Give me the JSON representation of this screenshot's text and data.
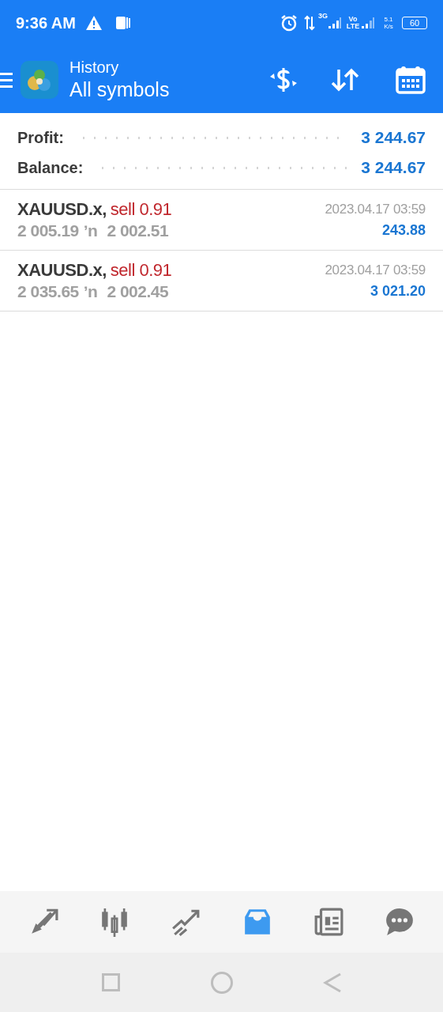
{
  "status_bar": {
    "time": "9:36 AM",
    "network_1": "3G",
    "network_2": "Vo LTE",
    "speed": "5.1 K/s",
    "battery": "60"
  },
  "header": {
    "title": "History",
    "subtitle": "All symbols"
  },
  "summary": [
    {
      "label": "Profit:",
      "value": "3 244.67"
    },
    {
      "label": "Balance:",
      "value": "3 244.67"
    }
  ],
  "deals": [
    {
      "symbol": "XAUUSD.x,",
      "action": "sell 0.91",
      "open_price": "2 005.19",
      "arrow": "ʼn",
      "close_price": "2 002.51",
      "time": "2023.04.17 03:59",
      "profit": "243.88"
    },
    {
      "symbol": "XAUUSD.x,",
      "action": "sell 0.91",
      "open_price": "2 035.65",
      "arrow": "ʼn",
      "close_price": "2 002.45",
      "time": "2023.04.17 03:59",
      "profit": "3 021.20"
    }
  ],
  "bottom_nav": [
    {
      "kind": "quotes",
      "selected": false
    },
    {
      "kind": "chart",
      "selected": false
    },
    {
      "kind": "trade",
      "selected": false
    },
    {
      "kind": "history",
      "selected": true
    },
    {
      "kind": "news",
      "selected": false
    },
    {
      "kind": "chat",
      "selected": false
    }
  ]
}
